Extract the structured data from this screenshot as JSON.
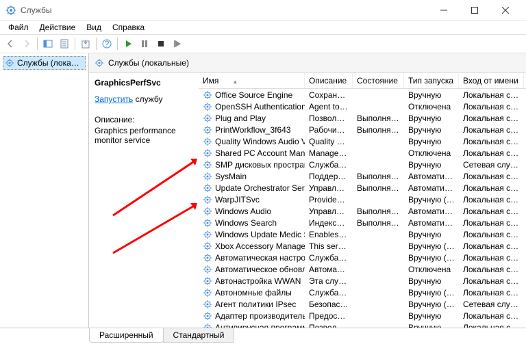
{
  "window": {
    "title": "Службы"
  },
  "menus": [
    "Файл",
    "Действие",
    "Вид",
    "Справка"
  ],
  "left_tree": {
    "label": "Службы (локальные)"
  },
  "right_header": {
    "label": "Службы (локальные)"
  },
  "detail": {
    "name": "GraphicsPerfSvc",
    "action_link": "Запустить",
    "action_suffix": " службу",
    "desc_label": "Описание:",
    "desc_text": "Graphics performance monitor service"
  },
  "columns": [
    "Имя",
    "Описание",
    "Состояние",
    "Тип запуска",
    "Вход от имени"
  ],
  "rows": [
    [
      "Office Source Engine",
      "Сохранен...",
      "",
      "Вручную",
      "Локальная сис..."
    ],
    [
      "OpenSSH Authentication A...",
      "Agent to h...",
      "",
      "Отключена",
      "Локальная сис..."
    ],
    [
      "Plug and Play",
      "Позволяет...",
      "Выполняется",
      "Вручную",
      "Локальная сис..."
    ],
    [
      "PrintWorkflow_3f643",
      "Рабочий п...",
      "Выполняется",
      "Вручную",
      "Локальная сис..."
    ],
    [
      "Quality Windows Audio Vid...",
      "Quality Wi...",
      "",
      "Вручную",
      "Локальная слу..."
    ],
    [
      "Shared PC Account Manager",
      "Manages p...",
      "",
      "Отключена",
      "Локальная сис..."
    ],
    [
      "SMP дисковых пространст...",
      "Служба уз...",
      "",
      "Вручную",
      "Сетевая служба"
    ],
    [
      "SysMain",
      "Поддержи...",
      "Выполняется",
      "Автоматиче...",
      "Локальная сис..."
    ],
    [
      "Update Orchestrator Service",
      "Управляет...",
      "Выполняется",
      "Автоматиче...",
      "Локальная сис..."
    ],
    [
      "WarpJITSvc",
      "Provides a ...",
      "",
      "Вручную (ак...",
      "Локальная слу..."
    ],
    [
      "Windows Audio",
      "Управлен...",
      "Выполняется",
      "Автоматиче...",
      "Локальная слу..."
    ],
    [
      "Windows Search",
      "Индексир...",
      "Выполняется",
      "Автоматиче...",
      "Локальная сис..."
    ],
    [
      "Windows Update Medic Ser...",
      "Enables re...",
      "",
      "Вручную",
      "Локальная сис..."
    ],
    [
      "Xbox Accessory Manageme...",
      "This servic...",
      "",
      "Вручную (ак...",
      "Локальная сис..."
    ],
    [
      "Автоматическая настройк...",
      "Служба ав...",
      "",
      "Вручную (ак...",
      "Локальная сис..."
    ],
    [
      "Автоматическое обновле...",
      "Автомати...",
      "",
      "Отключена",
      "Локальная сис..."
    ],
    [
      "Автонастройка WWAN",
      "Эта служб...",
      "",
      "Вручную",
      "Локальная сис..."
    ],
    [
      "Автономные файлы",
      "Служба ав...",
      "",
      "Вручную (ак...",
      "Локальная сис..."
    ],
    [
      "Агент политики IPsec",
      "Безопасно...",
      "",
      "Вручную (ак...",
      "Сетевая служба"
    ],
    [
      "Адаптер производительно...",
      "Предостав...",
      "",
      "Вручную",
      "Локальная сис..."
    ],
    [
      "Антивирусная программа ...",
      "Позволяет...",
      "",
      "Вручную",
      "Локальная сис..."
    ]
  ],
  "tabs": {
    "extended": "Расширенный",
    "standard": "Стандартный"
  }
}
